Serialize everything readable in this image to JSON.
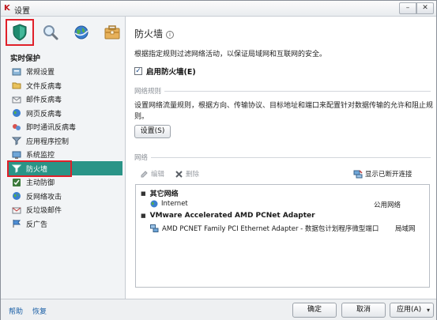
{
  "window": {
    "title": "设置",
    "minimize_glyph": "–",
    "close_glyph": "✕"
  },
  "tabs": [
    {
      "name": "protection-tab",
      "icon": "shield-icon",
      "active": true
    },
    {
      "name": "scan-tab",
      "icon": "magnifier-icon",
      "active": false
    },
    {
      "name": "update-tab",
      "icon": "globe-icon",
      "active": false
    },
    {
      "name": "options-tab",
      "icon": "toolbox-icon",
      "active": false
    }
  ],
  "sidebar": {
    "section_title": "实时保护",
    "items": [
      {
        "label": "常规设置",
        "icon": "settings-icon"
      },
      {
        "label": "文件反病毒",
        "icon": "folder-icon"
      },
      {
        "label": "邮件反病毒",
        "icon": "mail-icon"
      },
      {
        "label": "网页反病毒",
        "icon": "web-icon"
      },
      {
        "label": "即时通讯反病毒",
        "icon": "chat-icon"
      },
      {
        "label": "应用程序控制",
        "icon": "filter-icon"
      },
      {
        "label": "系统监控",
        "icon": "monitor-icon"
      },
      {
        "label": "防火墙",
        "icon": "firewall-icon",
        "selected": true
      },
      {
        "label": "主动防御",
        "icon": "defense-icon"
      },
      {
        "label": "反网络攻击",
        "icon": "network-attack-icon"
      },
      {
        "label": "反垃圾邮件",
        "icon": "antispam-icon"
      },
      {
        "label": "反广告",
        "icon": "antibanner-icon"
      }
    ]
  },
  "main": {
    "heading": "防火墙",
    "info_glyph": "i",
    "description": "根据指定规则过滤网络活动，以保证局域网和互联网的安全。",
    "enable_label": "启用防火墙(E)",
    "enable_checked": true,
    "rules_group": "网络规则",
    "rules_text": "设置网络流量规则，根据方向、传输协议、目标地址和端口来配置针对数据传输的允许和阻止规则。",
    "settings_button": "设置(S)",
    "network_group": "网络",
    "toolbar": {
      "edit_label": "编辑",
      "delete_label": "删除",
      "show_disconnected_label": "显示已断开连接"
    },
    "networks": [
      {
        "group": "其它网络",
        "name": "Internet",
        "type": "公用网络"
      },
      {
        "group": "VMware Accelerated AMD PCNet Adapter",
        "name": "AMD PCNET Family PCI Ethernet Adapter - 数据包计划程序微型端口",
        "type": "局域网"
      }
    ]
  },
  "footer": {
    "help_link": "帮助",
    "restore_link": "恢复",
    "ok_button": "确定",
    "cancel_button": "取消",
    "apply_button": "应用(A)",
    "apply_dropdown_glyph": "▾"
  },
  "colors": {
    "selected_bg": "#2a9487",
    "highlight_border": "#e0202a",
    "link": "#1a5fa6"
  }
}
